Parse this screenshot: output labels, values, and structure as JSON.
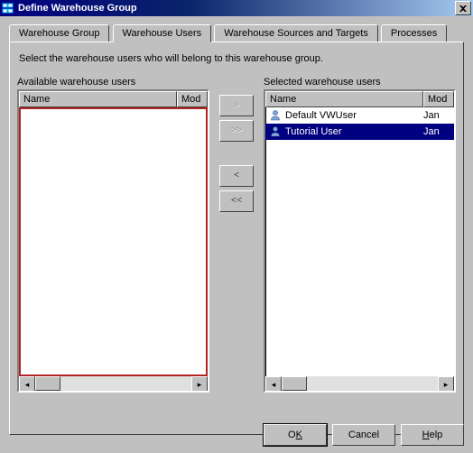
{
  "window": {
    "title": "Define Warehouse Group"
  },
  "tabs": {
    "group": "Warehouse Group",
    "users": "Warehouse Users",
    "sources": "Warehouse Sources and Targets",
    "processes": "Processes"
  },
  "instruction": "Select the warehouse users who will belong to this warehouse group.",
  "available": {
    "label": "Available warehouse users",
    "headers": {
      "name": "Name",
      "mod": "Mod"
    },
    "rows": []
  },
  "selected": {
    "label": "Selected warehouse users",
    "headers": {
      "name": "Name",
      "mod": "Mod"
    },
    "rows": [
      {
        "name": "Default VWUser",
        "mod": "Jan",
        "selected": false
      },
      {
        "name": "Tutorial User",
        "mod": "Jan",
        "selected": true
      }
    ]
  },
  "transfer": {
    "add": ">",
    "addAll": ">>",
    "remove": "<",
    "removeAll": "<<"
  },
  "buttons": {
    "ok_pre": "O",
    "ok_m": "K",
    "ok_post": "",
    "cancel": "Cancel",
    "help_pre": "",
    "help_m": "H",
    "help_post": "elp"
  }
}
